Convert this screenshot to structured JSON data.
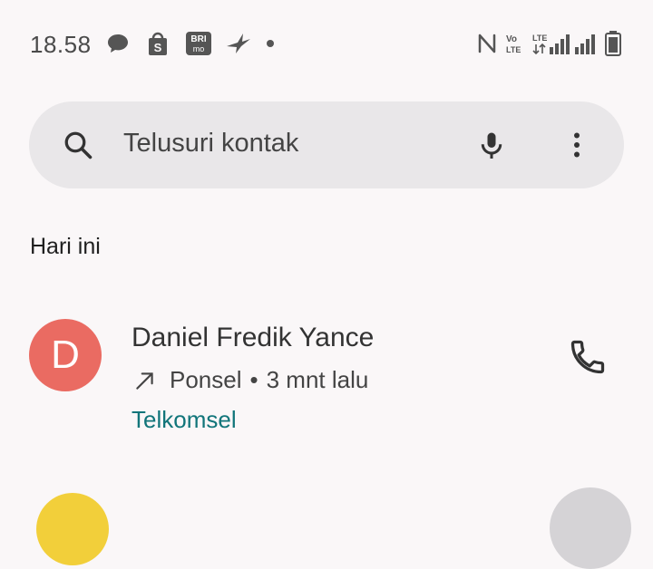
{
  "status_bar": {
    "time": "18.58",
    "left_icons": [
      "chat-bubble-icon",
      "shopee-icon",
      "brimo-icon",
      "bird-app-icon",
      "dot-icon"
    ],
    "brimo_line1": "BRI",
    "brimo_line2": "mo",
    "right_icons": [
      "nfc-icon",
      "volte-icon",
      "lte-signal-icon",
      "signal-icon",
      "battery-icon"
    ],
    "volte_line1": "Vo",
    "volte_line2": "LTE",
    "lte_label": "LTE"
  },
  "search": {
    "placeholder": "Telusuri kontak",
    "icons": [
      "search-icon",
      "microphone-icon",
      "more-vert-icon"
    ]
  },
  "section": {
    "label": "Hari ini"
  },
  "recent_calls": [
    {
      "initial": "D",
      "name": "Daniel Fredik Yance",
      "direction_icon": "outgoing-arrow-icon",
      "type": "Ponsel",
      "separator": "•",
      "time": "3 mnt lalu",
      "carrier": "Telkomsel",
      "avatar_color": "#ea6b62",
      "carrier_color": "#11757a"
    }
  ],
  "colors": {
    "background": "#faf7f8",
    "search_bar": "#e9e7e9"
  }
}
